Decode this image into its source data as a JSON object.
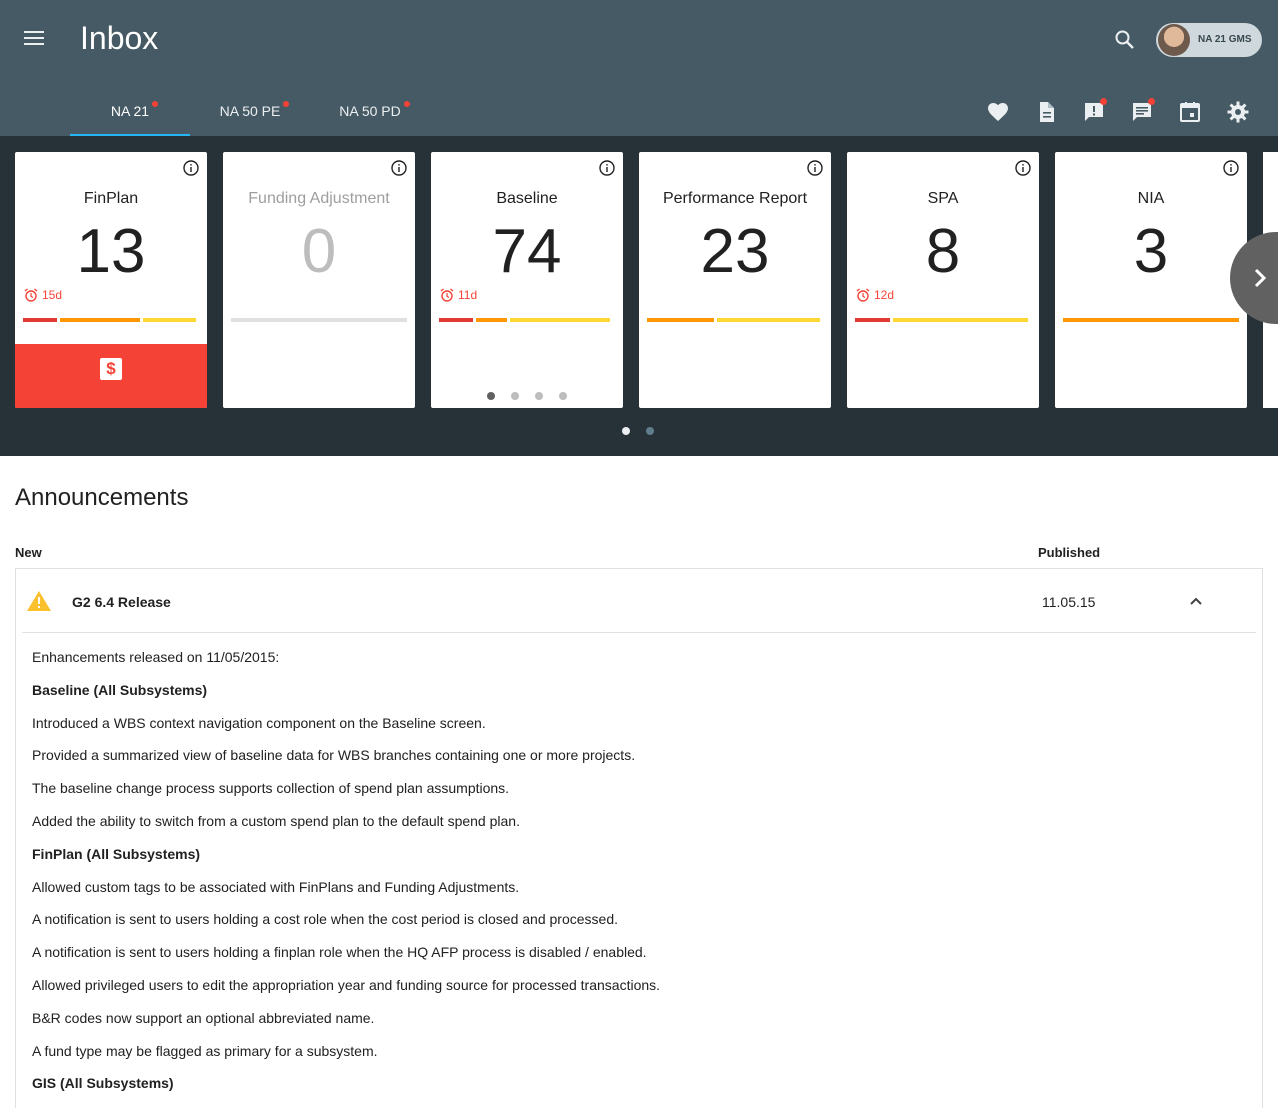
{
  "header": {
    "title": "Inbox",
    "user_chip_label": "NA 21 GMS"
  },
  "tabs": [
    {
      "label": "NA 21",
      "active": true,
      "has_alert": true
    },
    {
      "label": "NA 50 PE",
      "active": false,
      "has_alert": true
    },
    {
      "label": "NA 50 PD",
      "active": false,
      "has_alert": true
    }
  ],
  "toolbar": {
    "icons": [
      "favorite-icon",
      "document-icon",
      "alert-message-icon",
      "chat-icon",
      "calendar-icon",
      "settings-icon"
    ],
    "alerts": {
      "alert-message-icon": true,
      "chat-icon": true
    }
  },
  "cards": [
    {
      "title": "FinPlan",
      "count": "13",
      "due": "15d",
      "footer": "dollar-icon",
      "bar_colors": [
        "#e53935",
        "#ff9800",
        "#fdd835"
      ],
      "bar_fractions": [
        0.2,
        0.47,
        0.31
      ]
    },
    {
      "title": "Funding Adjustment",
      "count": "0",
      "muted": true,
      "bar_colors": [
        "#e0e0e0"
      ],
      "bar_fractions": [
        1
      ]
    },
    {
      "title": "Baseline",
      "count": "74",
      "due": "11d",
      "bar_colors": [
        "#e53935",
        "#ff9800",
        "#fdd835"
      ],
      "bar_fractions": [
        0.2,
        0.18,
        0.59
      ],
      "pager_dots": 4,
      "pager_active": 0
    },
    {
      "title": "Performance Report",
      "count": "23",
      "bar_colors": [
        "#ff9800",
        "#fdd835"
      ],
      "bar_fractions": [
        0.39,
        0.59
      ]
    },
    {
      "title": "SPA",
      "count": "8",
      "due": "12d",
      "bar_colors": [
        "#e53935",
        "#fdd835"
      ],
      "bar_fractions": [
        0.2,
        0.78
      ]
    },
    {
      "title": "NIA",
      "count": "3",
      "bar_colors": [
        "#ff9800"
      ],
      "bar_fractions": [
        1
      ]
    }
  ],
  "carousel": {
    "pages": 2,
    "active_page": 0
  },
  "announcements": {
    "title": "Announcements",
    "col_new": "New",
    "col_published": "Published",
    "items": [
      {
        "name": "G2 6.4 Release",
        "published": "11.05.15",
        "lines": [
          {
            "text": "Enhancements released on 11/05/2015:",
            "bold": false
          },
          {
            "text": "Baseline (All Subsystems)",
            "bold": true
          },
          {
            "text": "Introduced a WBS context navigation component on the Baseline screen.",
            "bold": false
          },
          {
            "text": "Provided a summarized view of baseline data for WBS branches containing one or more projects.",
            "bold": false
          },
          {
            "text": "The baseline change process supports collection of spend plan assumptions.",
            "bold": false
          },
          {
            "text": "Added the ability to switch from a custom spend plan to the default spend plan.",
            "bold": false
          },
          {
            "text": "FinPlan (All Subsystems)",
            "bold": true
          },
          {
            "text": "Allowed custom tags to be associated with FinPlans and Funding Adjustments.",
            "bold": false
          },
          {
            "text": "A notification is sent to users holding a cost role when the cost period is closed and processed.",
            "bold": false
          },
          {
            "text": "A notification is sent to users holding a finplan role when the HQ AFP process is disabled / enabled.",
            "bold": false
          },
          {
            "text": "Allowed privileged users to edit the appropriation year and funding source for processed transactions.",
            "bold": false
          },
          {
            "text": "B&R codes now support an optional abbreviated name.",
            "bold": false
          },
          {
            "text": "A fund type may be flagged as primary for a subsystem.",
            "bold": false
          },
          {
            "text": "GIS (All Subsystems)",
            "bold": true
          }
        ]
      }
    ]
  },
  "colors": {
    "appbar": "#455a64",
    "band": "#263238",
    "tab_indicator": "#29b6f6",
    "alert": "#f44336"
  }
}
